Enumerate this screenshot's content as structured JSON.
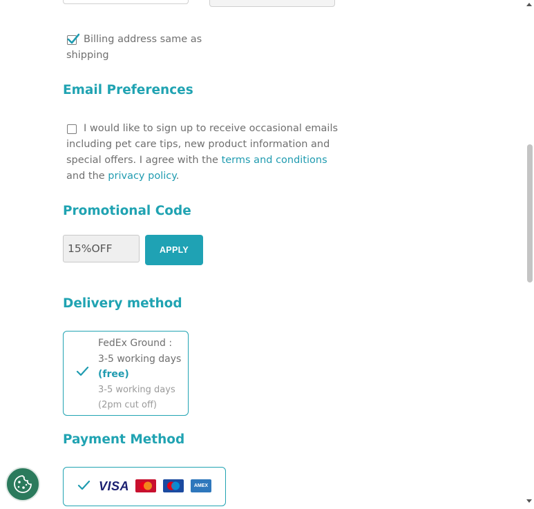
{
  "billing": {
    "same_as_shipping_label": "Billing address same as shipping",
    "same_as_shipping_checked": true
  },
  "email_preferences": {
    "heading": "Email Preferences",
    "signup_text_before": "I would like to sign up to receive occasional emails including pet care tips, new product information and special offers. I agree with the ",
    "terms_link": "terms and conditions",
    "text_middle": " and the ",
    "privacy_link": "privacy policy",
    "text_end": ".",
    "signup_checked": false
  },
  "promotional_code": {
    "heading": "Promotional Code",
    "input_value": "15%OFF",
    "apply_label": "APPLY"
  },
  "delivery": {
    "heading": "Delivery method",
    "option_name": "FedEx Ground : 3-5 working days",
    "option_price": "(free)",
    "option_description": "3-5 working days (2pm cut off)",
    "selected": true
  },
  "payment": {
    "heading": "Payment Method",
    "cards": [
      "VISA",
      "MasterCard",
      "Maestro",
      "AMEX"
    ]
  },
  "colors": {
    "accent": "#20a3b2",
    "button": "#1fa2b4",
    "cookie_button": "#2b7a5c"
  },
  "icons": {
    "cookie": "cookie-icon",
    "check": "checkmark-icon"
  }
}
